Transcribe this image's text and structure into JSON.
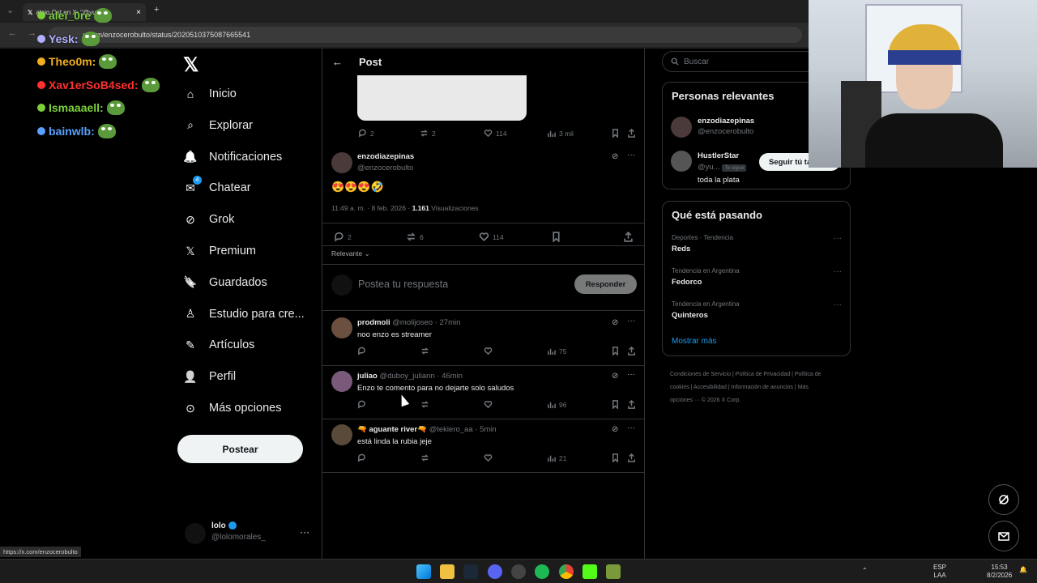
{
  "browser": {
    "tab_title": "aleio Ost en X: \"@yu",
    "url": "x.com/enzocerobulto/status/2020510375087665541",
    "status_url": "https://x.com/enzocerobulto"
  },
  "chat_overlay": [
    {
      "user": "alei_0re",
      "color": "#7ccf3c"
    },
    {
      "user": "Yesk:",
      "color": "#b0b0ff"
    },
    {
      "user": "Theo0m:",
      "color": "#f0b020"
    },
    {
      "user": "Xav1erSoB4sed:",
      "color": "#ff3030"
    },
    {
      "user": "Ismaaaell:",
      "color": "#7ccf3c"
    },
    {
      "user": "bainwlb:",
      "color": "#5aa0ff"
    }
  ],
  "sidebar": {
    "items": [
      {
        "label": "Inicio"
      },
      {
        "label": "Explorar"
      },
      {
        "label": "Notificaciones"
      },
      {
        "label": "Chatear",
        "badge": "4"
      },
      {
        "label": "Grok"
      },
      {
        "label": "Premium"
      },
      {
        "label": "Guardados"
      },
      {
        "label": "Estudio para cre..."
      },
      {
        "label": "Artículos"
      },
      {
        "label": "Perfil"
      },
      {
        "label": "Más opciones"
      }
    ],
    "post_button": "Postear",
    "account": {
      "name": "lolo",
      "handle": "@lolomorales_"
    }
  },
  "main": {
    "header_title": "Post",
    "top_actions": {
      "replies": "2",
      "reposts": "2",
      "likes": "114",
      "views": "3 mil"
    },
    "post": {
      "name": "enzodiazepinas",
      "handle": "@enzocerobulto",
      "text": "😍😍😍🤣",
      "time": "11:49 a. m. · 8 feb. 2026 ·",
      "views_count": "1.161",
      "views_label": "Visualizaciones",
      "replies": "2",
      "reposts": "6",
      "likes": "114"
    },
    "sort_label": "Relevante",
    "reply_placeholder": "Postea tu respuesta",
    "reply_button": "Responder",
    "replies": [
      {
        "name": "prodmoli",
        "handle": "@molijoseo",
        "time": "· 27min",
        "text": "noo enzo es streamer",
        "views": "75",
        "avatar_color": "#6b5040"
      },
      {
        "name": "juliao",
        "handle": "@duboy_juliann",
        "time": "· 46min",
        "text": "Enzo te comento para no dejarte solo saludos",
        "views": "96",
        "avatar_color": "#7a5a7a"
      },
      {
        "name": "🔫 aguante river🔫",
        "handle": "@tekiero_aa",
        "time": "· 5min",
        "text": "está linda la rubia jeje",
        "views": "21",
        "avatar_color": "#5a4a3a"
      }
    ]
  },
  "right": {
    "search_placeholder": "Buscar",
    "relevant_title": "Personas relevantes",
    "people": [
      {
        "name": "enzodiazepinas",
        "handle": "@enzocerobulto"
      },
      {
        "name": "HustlerStar",
        "handle": "@yu...",
        "follows_you": "Te sigue",
        "bio": "toda la plata",
        "button": "Seguir tú ta"
      }
    ],
    "trends_title": "Qué está pasando",
    "trends": [
      {
        "context": "Deportes · Tendencia",
        "name": "Reds"
      },
      {
        "context": "Tendencia en Argentina",
        "name": "Fedorco"
      },
      {
        "context": "Tendencia en Argentina",
        "name": "Quinteros"
      }
    ],
    "show_more": "Mostrar más",
    "footer": "Condiciones de Servicio | Política de Privacidad | Política de cookies | Accesibilidad | Información de anuncios | Más opciones ··· © 2026 X Corp."
  },
  "taskbar": {
    "lang": "ESP",
    "layout": "LAA",
    "time": "15:53",
    "date": "8/2/2026"
  },
  "colors": {
    "accent": "#1d9bf0",
    "bg": "#000000",
    "border": "#2f3336",
    "muted": "#71767b"
  }
}
